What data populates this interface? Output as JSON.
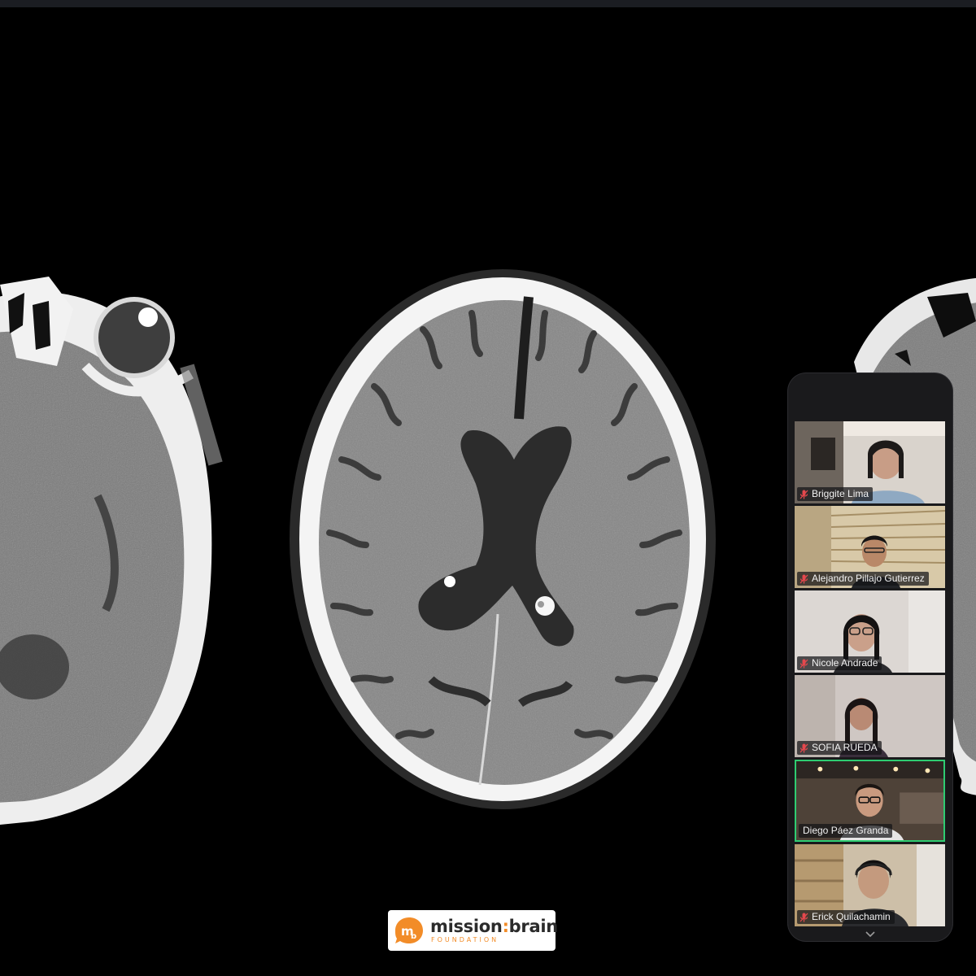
{
  "meeting": {
    "participants": [
      {
        "name": "Briggite Lima",
        "muted": true,
        "active": false
      },
      {
        "name": "Alejandro Pillajo Gutierrez",
        "muted": true,
        "active": false
      },
      {
        "name": "Nicole Andrade",
        "muted": true,
        "active": false
      },
      {
        "name": "SOFIA RUEDA",
        "muted": true,
        "active": false
      },
      {
        "name": "Diego Páez Granda",
        "muted": false,
        "active": true
      },
      {
        "name": "Erick Quilachamin",
        "muted": true,
        "active": false
      }
    ]
  },
  "logo": {
    "word_left": "mission",
    "word_sep": ":",
    "word_right": "brain",
    "subtitle": "FOUNDATION",
    "brand_color": "#f28c28"
  },
  "colors": {
    "active_speaker_border": "#2ecc71",
    "muted_icon": "#e5484d",
    "panel_bg": "#1a1a1c"
  }
}
